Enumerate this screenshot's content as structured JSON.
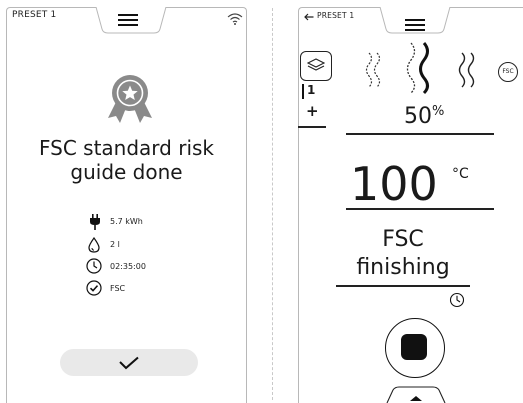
{
  "left_panel": {
    "header": {
      "preset": "PRESET 1",
      "menu_icon": "hamburger-icon",
      "wifi_icon": "wifi-icon"
    },
    "badge_icon": "award-ribbon-icon",
    "title_line1": "FSC standard risk",
    "title_line2": "guide done",
    "stats": [
      {
        "icon": "plug-icon",
        "value": "5.7 kWh"
      },
      {
        "icon": "water-drop-icon",
        "value": "2 l"
      },
      {
        "icon": "clock-icon",
        "value": "02:35:00"
      },
      {
        "icon": "check-circle-icon",
        "value": "FSC"
      }
    ],
    "confirm_icon": "checkmark-icon"
  },
  "right_panel": {
    "header": {
      "preset": "PRESET 1",
      "back_icon": "arrow-left-icon",
      "menu_icon": "hamburger-icon"
    },
    "layers_icon": "layers-icon",
    "level_value": "1",
    "plus_label": "+",
    "steam_levels": [
      "low",
      "medium",
      "high"
    ],
    "fsc_badge": "FSC",
    "humidity": {
      "value": "50",
      "unit": "%"
    },
    "temperature": {
      "value": "100",
      "unit": "°C"
    },
    "phase_line1": "FSC",
    "phase_line2": "finishing",
    "timer_icon": "clock-icon",
    "stop_icon": "stop-icon",
    "expand_icon": "chevron-up-icon"
  }
}
